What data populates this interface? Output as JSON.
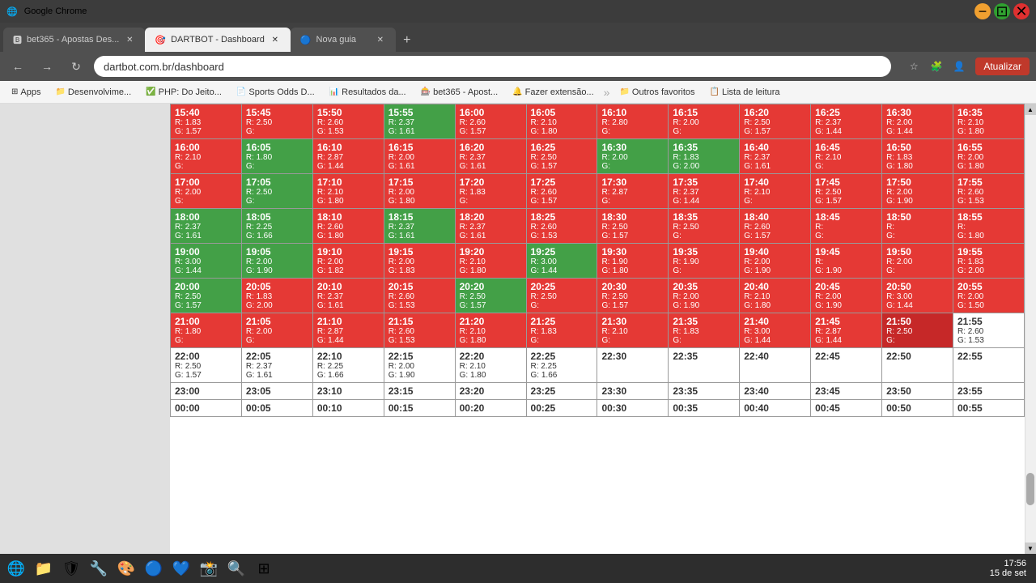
{
  "titlebar": {
    "title": "Google Chrome",
    "icon": "🌐"
  },
  "tabs": [
    {
      "label": "bet365 - Apostas Des...",
      "active": false,
      "icon": "🅱"
    },
    {
      "label": "DARTBOT - Dashboard",
      "active": true,
      "icon": "🎯"
    },
    {
      "label": "Nova guia",
      "active": false,
      "icon": "🔵"
    }
  ],
  "addressbar": {
    "url": "dartbot.com.br/dashboard",
    "update_label": "Atualizar"
  },
  "bookmarks": [
    {
      "label": "Apps",
      "icon": "⊞"
    },
    {
      "label": "Desenvolvime...",
      "icon": "📁"
    },
    {
      "label": "PHP: Do Jeito...",
      "icon": "✅"
    },
    {
      "label": "Sports Odds D...",
      "icon": "📄"
    },
    {
      "label": "Resultados da...",
      "icon": "📊"
    },
    {
      "label": "bet365 - Apost...",
      "icon": "🎰"
    },
    {
      "label": "Fazer extensão...",
      "icon": "🔔"
    },
    {
      "label": "Outros favoritos",
      "icon": "📁"
    },
    {
      "label": "Lista de leitura",
      "icon": "📋"
    }
  ],
  "rows": [
    {
      "cells": [
        {
          "time": "15:40",
          "r": "R: 1.83",
          "g": "G: 1.57",
          "color": "red"
        },
        {
          "time": "15:45",
          "r": "R: 2.50",
          "g": "G: ",
          "color": "red"
        },
        {
          "time": "15:50",
          "r": "R: 2.60",
          "g": "G: 1.53",
          "color": "red"
        },
        {
          "time": "15:55",
          "r": "R: 2.37",
          "g": "G: 1.61",
          "color": "green"
        },
        {
          "time": "16:00",
          "r": "R: 2.60",
          "g": "G: 1.57",
          "color": "red"
        },
        {
          "time": "16:05",
          "r": "R: 2.10",
          "g": "G: 1.80",
          "color": "red"
        },
        {
          "time": "16:10",
          "r": "R: 2.80",
          "g": "G: ",
          "color": "red"
        },
        {
          "time": "16:15",
          "r": "R: 2.00",
          "g": "G: ",
          "color": "red"
        },
        {
          "time": "16:20",
          "r": "R: 2.50",
          "g": "G: 1.57",
          "color": "red"
        },
        {
          "time": "16:25",
          "r": "R: 2.37",
          "g": "G: 1.44",
          "color": "red"
        },
        {
          "time": "16:30",
          "r": "R: 2.00",
          "g": "G: 1.44",
          "color": "red"
        },
        {
          "time": "16:35",
          "r": "R: 2.10",
          "g": "G: 1.80",
          "color": "red"
        }
      ]
    },
    {
      "cells": [
        {
          "time": "16:00",
          "r": "R: 2.10",
          "g": "G: ",
          "color": "red"
        },
        {
          "time": "16:05",
          "r": "R: 1.80",
          "g": "G: ",
          "color": "green"
        },
        {
          "time": "16:10",
          "r": "R: 2.87",
          "g": "G: 1.44",
          "color": "red"
        },
        {
          "time": "16:15",
          "r": "R: 2.00",
          "g": "G: 1.61",
          "color": "red"
        },
        {
          "time": "16:20",
          "r": "R: 2.37",
          "g": "G: 1.61",
          "color": "red"
        },
        {
          "time": "16:25",
          "r": "R: 2.50",
          "g": "G: 1.57",
          "color": "red"
        },
        {
          "time": "16:30",
          "r": "R: 2.00",
          "g": "G: ",
          "color": "green"
        },
        {
          "time": "16:35",
          "r": "R: 1.83",
          "g": "G: 2.00",
          "color": "green"
        },
        {
          "time": "16:40",
          "r": "R: 2.37",
          "g": "G: 1.61",
          "color": "red"
        },
        {
          "time": "16:45",
          "r": "R: 2.10",
          "g": "G: ",
          "color": "red"
        },
        {
          "time": "16:50",
          "r": "R: 1.83",
          "g": "G: 1.80",
          "color": "red"
        },
        {
          "time": "16:55",
          "r": "R: 2.00",
          "g": "G: 1.80",
          "color": "red"
        }
      ]
    },
    {
      "cells": [
        {
          "time": "17:00",
          "r": "R: 2.00",
          "g": "G: ",
          "color": "red"
        },
        {
          "time": "17:05",
          "r": "R: 2.50",
          "g": "G: ",
          "color": "green"
        },
        {
          "time": "17:10",
          "r": "R: 2.10",
          "g": "G: 1.80",
          "color": "red"
        },
        {
          "time": "17:15",
          "r": "R: 2.00",
          "g": "G: 1.80",
          "color": "red"
        },
        {
          "time": "17:20",
          "r": "R: 1.83",
          "g": "G: ",
          "color": "red"
        },
        {
          "time": "17:25",
          "r": "R: 2.60",
          "g": "G: 1.57",
          "color": "red"
        },
        {
          "time": "17:30",
          "r": "R: 2.87",
          "g": "G: ",
          "color": "red"
        },
        {
          "time": "17:35",
          "r": "R: 2.37",
          "g": "G: 1.44",
          "color": "red"
        },
        {
          "time": "17:40",
          "r": "R: 2.10",
          "g": "G: ",
          "color": "red"
        },
        {
          "time": "17:45",
          "r": "R: 2.50",
          "g": "G: 1.57",
          "color": "red"
        },
        {
          "time": "17:50",
          "r": "R: 2.00",
          "g": "G: 1.90",
          "color": "red"
        },
        {
          "time": "17:55",
          "r": "R: 2.60",
          "g": "G: 1.53",
          "color": "red"
        }
      ]
    },
    {
      "cells": [
        {
          "time": "18:00",
          "r": "R: 2.37",
          "g": "G: 1.61",
          "color": "green"
        },
        {
          "time": "18:05",
          "r": "R: 2.25",
          "g": "G: 1.66",
          "color": "green"
        },
        {
          "time": "18:10",
          "r": "R: 2.60",
          "g": "G: 1.80",
          "color": "red"
        },
        {
          "time": "18:15",
          "r": "R: 2.37",
          "g": "G: 1.61",
          "color": "green"
        },
        {
          "time": "18:20",
          "r": "R: 2.37",
          "g": "G: 1.61",
          "color": "red"
        },
        {
          "time": "18:25",
          "r": "R: 2.60",
          "g": "G: 1.53",
          "color": "red"
        },
        {
          "time": "18:30",
          "r": "R: 2.50",
          "g": "G: 1.57",
          "color": "red"
        },
        {
          "time": "18:35",
          "r": "R: 2.50",
          "g": "G: ",
          "color": "red"
        },
        {
          "time": "18:40",
          "r": "R: 2.60",
          "g": "G: 1.57",
          "color": "red"
        },
        {
          "time": "18:45",
          "r": "R: ",
          "g": "G: ",
          "color": "red"
        },
        {
          "time": "18:50",
          "r": "R: ",
          "g": "G: ",
          "color": "red"
        },
        {
          "time": "18:55",
          "r": "R: ",
          "g": "G: 1.80",
          "color": "red"
        }
      ]
    },
    {
      "cells": [
        {
          "time": "19:00",
          "r": "R: 3.00",
          "g": "G: 1.44",
          "color": "green"
        },
        {
          "time": "19:05",
          "r": "R: 2.00",
          "g": "G: 1.90",
          "color": "green"
        },
        {
          "time": "19:10",
          "r": "R: 2.00",
          "g": "G: 1.82",
          "color": "red"
        },
        {
          "time": "19:15",
          "r": "R: 2.00",
          "g": "G: 1.83",
          "color": "red"
        },
        {
          "time": "19:20",
          "r": "R: 2.10",
          "g": "G: 1.80",
          "color": "red"
        },
        {
          "time": "19:25",
          "r": "R: 3.00",
          "g": "G: 1.44",
          "color": "green"
        },
        {
          "time": "19:30",
          "r": "R: 1.90",
          "g": "G: 1.80",
          "color": "red"
        },
        {
          "time": "19:35",
          "r": "R: 1.90",
          "g": "G: ",
          "color": "red"
        },
        {
          "time": "19:40",
          "r": "R: 2.00",
          "g": "G: 1.90",
          "color": "red"
        },
        {
          "time": "19:45",
          "r": "R: ",
          "g": "G: 1.90",
          "color": "red"
        },
        {
          "time": "19:50",
          "r": "R: 2.00",
          "g": "G: ",
          "color": "red"
        },
        {
          "time": "19:55",
          "r": "R: 1.83",
          "g": "G: 2.00",
          "color": "red"
        }
      ]
    },
    {
      "cells": [
        {
          "time": "20:00",
          "r": "R: 2.50",
          "g": "G: 1.57",
          "color": "green"
        },
        {
          "time": "20:05",
          "r": "R: 1.83",
          "g": "G: 2.00",
          "color": "red"
        },
        {
          "time": "20:10",
          "r": "R: 2.37",
          "g": "G: 1.61",
          "color": "red"
        },
        {
          "time": "20:15",
          "r": "R: 2.60",
          "g": "G: 1.53",
          "color": "red"
        },
        {
          "time": "20:20",
          "r": "R: 2.50",
          "g": "G: 1.57",
          "color": "green"
        },
        {
          "time": "20:25",
          "r": "R: 2.50",
          "g": "G: ",
          "color": "red"
        },
        {
          "time": "20:30",
          "r": "R: 2.50",
          "g": "G: 1.57",
          "color": "red"
        },
        {
          "time": "20:35",
          "r": "R: 2.00",
          "g": "G: 1.90",
          "color": "red"
        },
        {
          "time": "20:40",
          "r": "R: 2.10",
          "g": "G: 1.80",
          "color": "red"
        },
        {
          "time": "20:45",
          "r": "R: 2.00",
          "g": "G: 1.90",
          "color": "red"
        },
        {
          "time": "20:50",
          "r": "R: 3.00",
          "g": "G: 1.44",
          "color": "red"
        },
        {
          "time": "20:55",
          "r": "R: 2.00",
          "g": "G: 1.50",
          "color": "red"
        }
      ]
    },
    {
      "cells": [
        {
          "time": "21:00",
          "r": "R: 1.80",
          "g": "G: ",
          "color": "red"
        },
        {
          "time": "21:05",
          "r": "R: 2.00",
          "g": "G: ",
          "color": "red"
        },
        {
          "time": "21:10",
          "r": "R: 2.87",
          "g": "G: 1.44",
          "color": "red"
        },
        {
          "time": "21:15",
          "r": "R: 2.60",
          "g": "G: 1.53",
          "color": "red"
        },
        {
          "time": "21:20",
          "r": "R: 2.10",
          "g": "G: 1.80",
          "color": "red"
        },
        {
          "time": "21:25",
          "r": "R: 1.83",
          "g": "G: ",
          "color": "red"
        },
        {
          "time": "21:30",
          "r": "R: 2.10",
          "g": "G: ",
          "color": "red"
        },
        {
          "time": "21:35",
          "r": "R: 1.83",
          "g": "G: ",
          "color": "red"
        },
        {
          "time": "21:40",
          "r": "R: 3.00",
          "g": "G: 1.44",
          "color": "red"
        },
        {
          "time": "21:45",
          "r": "R: 2.87",
          "g": "G: 1.44",
          "color": "red"
        },
        {
          "time": "21:50",
          "r": "R: 2.50",
          "g": "G: ",
          "color": "darkred"
        },
        {
          "time": "21:55",
          "r": "R: 2.60",
          "g": "G: 1.53",
          "color": "white"
        }
      ]
    },
    {
      "cells": [
        {
          "time": "22:00",
          "r": "R: 2.50",
          "g": "G: 1.57",
          "color": "white"
        },
        {
          "time": "22:05",
          "r": "R: 2.37",
          "g": "G: 1.61",
          "color": "white"
        },
        {
          "time": "22:10",
          "r": "R: 2.25",
          "g": "G: 1.66",
          "color": "white"
        },
        {
          "time": "22:15",
          "r": "R: 2.00",
          "g": "G: 1.90",
          "color": "white"
        },
        {
          "time": "22:20",
          "r": "R: 2.10",
          "g": "G: 1.80",
          "color": "white"
        },
        {
          "time": "22:25",
          "r": "R: 2.25",
          "g": "G: 1.66",
          "color": "white"
        },
        {
          "time": "22:30",
          "r": "",
          "g": "",
          "color": "white"
        },
        {
          "time": "22:35",
          "r": "",
          "g": "",
          "color": "white"
        },
        {
          "time": "22:40",
          "r": "",
          "g": "",
          "color": "white"
        },
        {
          "time": "22:45",
          "r": "",
          "g": "",
          "color": "white"
        },
        {
          "time": "22:50",
          "r": "",
          "g": "",
          "color": "white"
        },
        {
          "time": "22:55",
          "r": "",
          "g": "",
          "color": "white"
        }
      ]
    },
    {
      "cells": [
        {
          "time": "23:00",
          "r": "",
          "g": "",
          "color": "white"
        },
        {
          "time": "23:05",
          "r": "",
          "g": "",
          "color": "white"
        },
        {
          "time": "23:10",
          "r": "",
          "g": "",
          "color": "white"
        },
        {
          "time": "23:15",
          "r": "",
          "g": "",
          "color": "white"
        },
        {
          "time": "23:20",
          "r": "",
          "g": "",
          "color": "white"
        },
        {
          "time": "23:25",
          "r": "",
          "g": "",
          "color": "white"
        },
        {
          "time": "23:30",
          "r": "",
          "g": "",
          "color": "white"
        },
        {
          "time": "23:35",
          "r": "",
          "g": "",
          "color": "white"
        },
        {
          "time": "23:40",
          "r": "",
          "g": "",
          "color": "white"
        },
        {
          "time": "23:45",
          "r": "",
          "g": "",
          "color": "white"
        },
        {
          "time": "23:50",
          "r": "",
          "g": "",
          "color": "white"
        },
        {
          "time": "23:55",
          "r": "",
          "g": "",
          "color": "white"
        }
      ]
    },
    {
      "cells": [
        {
          "time": "00:00",
          "r": "",
          "g": "",
          "color": "white"
        },
        {
          "time": "00:05",
          "r": "",
          "g": "",
          "color": "white"
        },
        {
          "time": "00:10",
          "r": "",
          "g": "",
          "color": "white"
        },
        {
          "time": "00:15",
          "r": "",
          "g": "",
          "color": "white"
        },
        {
          "time": "00:20",
          "r": "",
          "g": "",
          "color": "white"
        },
        {
          "time": "00:25",
          "r": "",
          "g": "",
          "color": "white"
        },
        {
          "time": "00:30",
          "r": "",
          "g": "",
          "color": "white"
        },
        {
          "time": "00:35",
          "r": "",
          "g": "",
          "color": "white"
        },
        {
          "time": "00:40",
          "r": "",
          "g": "",
          "color": "white"
        },
        {
          "time": "00:45",
          "r": "",
          "g": "",
          "color": "white"
        },
        {
          "time": "00:50",
          "r": "",
          "g": "",
          "color": "white"
        },
        {
          "time": "00:55",
          "r": "",
          "g": "",
          "color": "white"
        }
      ]
    }
  ],
  "taskbar": {
    "date": "15 de set",
    "time": "17:56"
  },
  "taskbar_icons": [
    "🌐",
    "📁",
    "🛡",
    "🔧",
    "🎨",
    "🔵",
    "💙",
    "📸",
    "🔍",
    "⊞"
  ]
}
